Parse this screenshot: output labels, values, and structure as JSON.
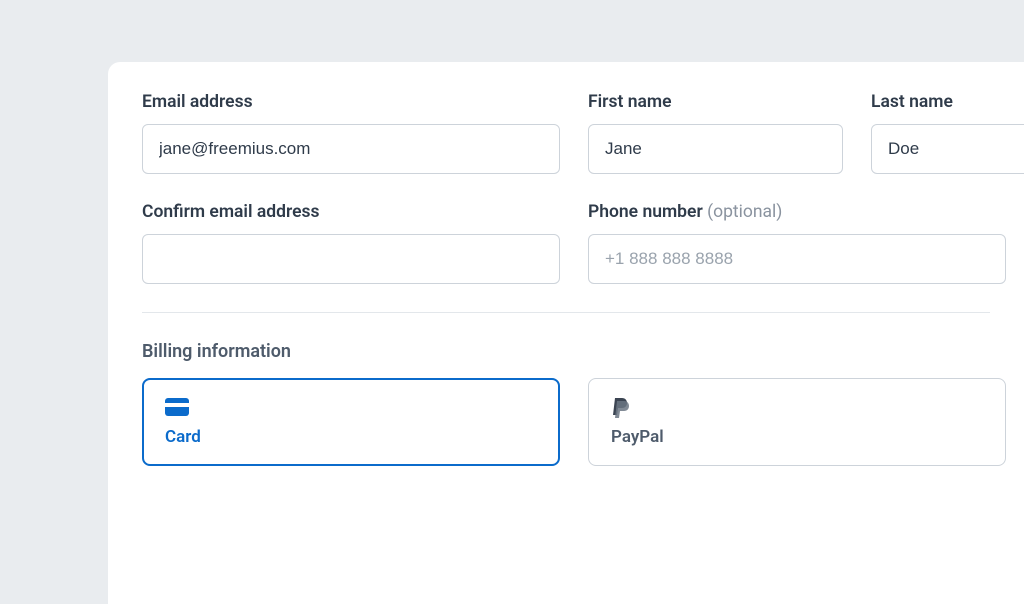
{
  "fields": {
    "email": {
      "label": "Email address",
      "value": "jane@freemius.com",
      "placeholder": ""
    },
    "first": {
      "label": "First name",
      "value": "Jane",
      "placeholder": ""
    },
    "last": {
      "label": "Last name",
      "value": "Doe",
      "placeholder": ""
    },
    "confirm": {
      "label": "Confirm email address",
      "value": "",
      "placeholder": ""
    },
    "phone": {
      "label": "Phone number",
      "optional": "(optional)",
      "value": "",
      "placeholder": "+1 888 888 8888"
    }
  },
  "billing": {
    "title": "Billing information",
    "card": {
      "label": "Card"
    },
    "paypal": {
      "label": "PayPal"
    }
  }
}
